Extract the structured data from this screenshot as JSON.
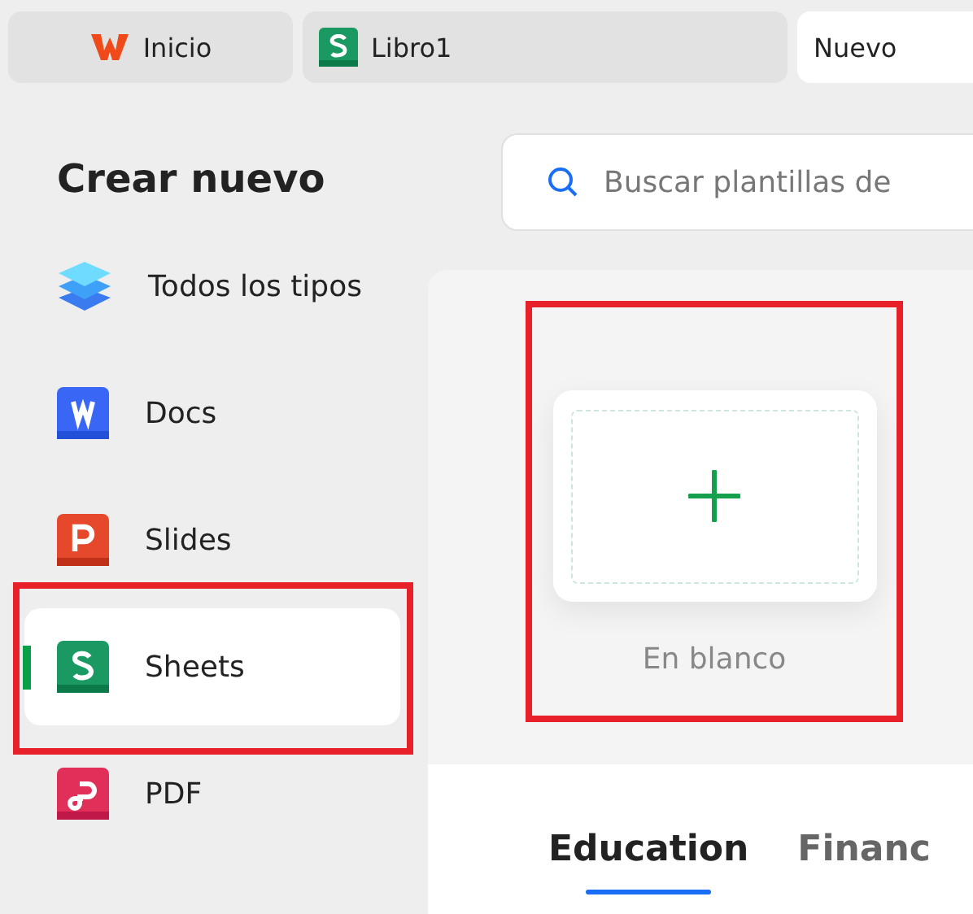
{
  "tabs": [
    {
      "kind": "home",
      "label": "Inicio",
      "selected": false
    },
    {
      "kind": "sheet",
      "label": "Libro1",
      "selected": false
    },
    {
      "kind": "plain",
      "label": "Nuevo",
      "selected": true
    }
  ],
  "heading": "Crear nuevo",
  "search": {
    "placeholder": "Buscar plantillas de"
  },
  "sidebar": {
    "items": [
      {
        "kind": "all",
        "label": "Todos los tipos",
        "selected": false,
        "highlighted": false
      },
      {
        "kind": "docs",
        "label": "Docs",
        "selected": false,
        "highlighted": false
      },
      {
        "kind": "slides",
        "label": "Slides",
        "selected": false,
        "highlighted": false
      },
      {
        "kind": "sheets",
        "label": "Sheets",
        "selected": true,
        "highlighted": true
      },
      {
        "kind": "pdf",
        "label": "PDF",
        "selected": false,
        "highlighted": false
      }
    ]
  },
  "templates": [
    {
      "label": "En blanco",
      "highlighted": true
    }
  ],
  "categories": [
    {
      "label": "Education",
      "selected": true
    },
    {
      "label": "Financ",
      "selected": false
    }
  ]
}
